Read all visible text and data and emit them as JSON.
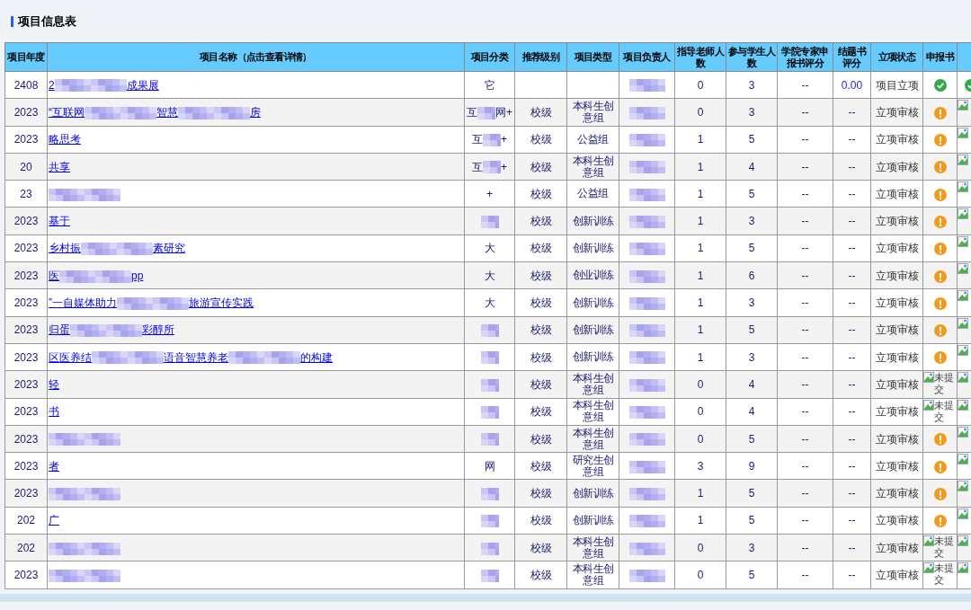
{
  "title": "项目信息表",
  "columns": [
    "项目年度",
    "项目名称（点击查看详情）",
    "项目分类",
    "推荐级别",
    "项目类型",
    "项目负责人",
    "指导老师人数",
    "参与学生人数",
    "学院专家申报书评分",
    "结题书评分",
    "立项状态",
    "申报书"
  ],
  "rows": [
    {
      "year": "2408",
      "name": [
        "2",
        "成果展"
      ],
      "category": [
        "它"
      ],
      "level": "",
      "type": "",
      "teachers": "0",
      "students": "3",
      "expert_score": "--",
      "final_score": "0.00",
      "final_scored": true,
      "status": "项目立项",
      "report": {
        "kind": "ok"
      },
      "contract": {
        "kind": "ok"
      }
    },
    {
      "year": "2023",
      "name": [
        "“互联网",
        "智慧",
        "房"
      ],
      "category": [
        "互",
        "网+"
      ],
      "level": "校级",
      "type": "本科生创意组",
      "teachers": "0",
      "students": "3",
      "expert_score": "--",
      "final_score": "--",
      "final_scored": false,
      "status": "立项审核",
      "report": {
        "kind": "warn"
      },
      "contract": {
        "kind": "missing"
      }
    },
    {
      "year": "2023",
      "name": [
        "略思考"
      ],
      "category": [
        "互",
        "+"
      ],
      "level": "校级",
      "type": "公益组",
      "teachers": "1",
      "students": "5",
      "expert_score": "--",
      "final_score": "--",
      "final_scored": false,
      "status": "立项审核",
      "report": {
        "kind": "warn"
      },
      "contract": {
        "kind": "missing"
      }
    },
    {
      "year": "20",
      "name": [
        "共享"
      ],
      "category": [
        "互",
        "+"
      ],
      "level": "校级",
      "type": "本科生创意组",
      "teachers": "1",
      "students": "4",
      "expert_score": "--",
      "final_score": "--",
      "final_scored": false,
      "status": "立项审核",
      "report": {
        "kind": "warn"
      },
      "contract": {
        "kind": "missing"
      }
    },
    {
      "year": "23",
      "name": [],
      "category": [
        "+"
      ],
      "level": "校级",
      "type": "公益组",
      "teachers": "1",
      "students": "5",
      "expert_score": "--",
      "final_score": "--",
      "final_scored": false,
      "status": "立项审核",
      "report": {
        "kind": "warn"
      },
      "contract": {
        "kind": "missing"
      }
    },
    {
      "year": "2023",
      "name": [
        "基于"
      ],
      "category": [],
      "level": "校级",
      "type": "创新训练",
      "teachers": "1",
      "students": "3",
      "expert_score": "--",
      "final_score": "--",
      "final_scored": false,
      "status": "立项审核",
      "report": {
        "kind": "warn"
      },
      "contract": {
        "kind": "missing"
      }
    },
    {
      "year": "2023",
      "name": [
        "乡村振",
        "素研究"
      ],
      "category": [
        "大"
      ],
      "level": "校级",
      "type": "创新训练",
      "teachers": "1",
      "students": "5",
      "expert_score": "--",
      "final_score": "--",
      "final_scored": false,
      "status": "立项审核",
      "report": {
        "kind": "warn"
      },
      "contract": {
        "kind": "missing"
      }
    },
    {
      "year": "2023",
      "name": [
        "医",
        "pp"
      ],
      "category": [
        "大"
      ],
      "level": "校级",
      "type": "创业训练",
      "teachers": "1",
      "students": "6",
      "expert_score": "--",
      "final_score": "--",
      "final_scored": false,
      "status": "立项审核",
      "report": {
        "kind": "warn"
      },
      "contract": {
        "kind": "missing"
      }
    },
    {
      "year": "2023",
      "name": [
        "”一自媒体助力",
        "旅游宣传实践"
      ],
      "category": [
        "大"
      ],
      "level": "校级",
      "type": "创新训练",
      "teachers": "1",
      "students": "3",
      "expert_score": "--",
      "final_score": "--",
      "final_scored": false,
      "status": "立项审核",
      "report": {
        "kind": "warn"
      },
      "contract": {
        "kind": "missing"
      }
    },
    {
      "year": "2023",
      "name": [
        "归蛋",
        "彩醇所"
      ],
      "category": [],
      "level": "校级",
      "type": "创新训练",
      "teachers": "1",
      "students": "5",
      "expert_score": "--",
      "final_score": "--",
      "final_scored": false,
      "status": "立项审核",
      "report": {
        "kind": "warn"
      },
      "contract": {
        "kind": "missing"
      }
    },
    {
      "year": "2023",
      "name": [
        "区医养结",
        "语音智慧养老",
        "的构建"
      ],
      "category": [],
      "level": "校级",
      "type": "创新训练",
      "teachers": "1",
      "students": "3",
      "expert_score": "--",
      "final_score": "--",
      "final_scored": false,
      "status": "立项审核",
      "report": {
        "kind": "warn"
      },
      "contract": {
        "kind": "missing"
      }
    },
    {
      "year": "2023",
      "name": [
        "轻"
      ],
      "category": [],
      "level": "校级",
      "type": "本科生创意组",
      "teachers": "0",
      "students": "4",
      "expert_score": "--",
      "final_score": "--",
      "final_scored": false,
      "status": "立项审核",
      "report": {
        "kind": "missing",
        "text": "未提交"
      },
      "contract": {
        "kind": "missing"
      }
    },
    {
      "year": "2023",
      "name": [
        "书"
      ],
      "category": [],
      "level": "校级",
      "type": "本科生创意组",
      "teachers": "0",
      "students": "4",
      "expert_score": "--",
      "final_score": "--",
      "final_scored": false,
      "status": "立项审核",
      "report": {
        "kind": "missing",
        "text": "未提交"
      },
      "contract": {
        "kind": "missing"
      }
    },
    {
      "year": "2023",
      "name": [],
      "category": [],
      "level": "校级",
      "type": "本科生创意组",
      "teachers": "0",
      "students": "5",
      "expert_score": "--",
      "final_score": "--",
      "final_scored": false,
      "status": "立项审核",
      "report": {
        "kind": "warn"
      },
      "contract": {
        "kind": "missing"
      }
    },
    {
      "year": "2023",
      "name": [
        "者"
      ],
      "category": [
        "网"
      ],
      "level": "校级",
      "type": "研究生创意组",
      "teachers": "3",
      "students": "9",
      "expert_score": "--",
      "final_score": "--",
      "final_scored": false,
      "status": "立项审核",
      "report": {
        "kind": "warn"
      },
      "contract": {
        "kind": "missing"
      }
    },
    {
      "year": "2023",
      "name": [],
      "category": [],
      "level": "校级",
      "type": "创新训练",
      "teachers": "1",
      "students": "5",
      "expert_score": "--",
      "final_score": "--",
      "final_scored": false,
      "status": "立项审核",
      "report": {
        "kind": "warn"
      },
      "contract": {
        "kind": "missing"
      }
    },
    {
      "year": "202",
      "name": [
        "广"
      ],
      "category": [],
      "level": "校级",
      "type": "创新训练",
      "teachers": "1",
      "students": "5",
      "expert_score": "--",
      "final_score": "--",
      "final_scored": false,
      "status": "立项审核",
      "report": {
        "kind": "warn"
      },
      "contract": {
        "kind": "missing"
      }
    },
    {
      "year": "202",
      "name": [],
      "category": [],
      "level": "校级",
      "type": "本科生创意组",
      "teachers": "0",
      "students": "3",
      "expert_score": "--",
      "final_score": "--",
      "final_scored": false,
      "status": "立项审核",
      "report": {
        "kind": "missing",
        "text": "未提交"
      },
      "contract": {
        "kind": "missing"
      }
    },
    {
      "year": "2023",
      "name": [],
      "category": [],
      "level": "校级",
      "type": "本科生创意组",
      "teachers": "0",
      "students": "5",
      "expert_score": "--",
      "final_score": "--",
      "final_scored": false,
      "status": "立项审核",
      "report": {
        "kind": "missing",
        "text": "未提交"
      },
      "contract": {
        "kind": "missing"
      }
    }
  ]
}
